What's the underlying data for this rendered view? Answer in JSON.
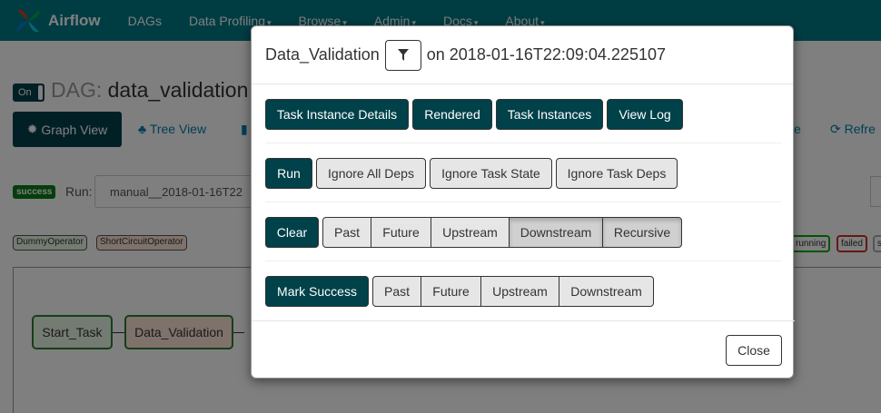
{
  "navbar": {
    "brand": "Airflow",
    "items": [
      {
        "label": "DAGs"
      },
      {
        "label": "Data Profiling",
        "caret": "▾"
      },
      {
        "label": "Browse",
        "caret": "▾"
      },
      {
        "label": "Admin",
        "caret": "▾"
      },
      {
        "label": "Docs",
        "caret": "▾"
      },
      {
        "label": "About",
        "caret": "▾"
      }
    ]
  },
  "page": {
    "toggle_label": "On",
    "dag_prefix": "DAG: ",
    "dag_name": "data_validation",
    "graph_view": "Graph View",
    "tree_view": "Tree View",
    "right_partial": "e",
    "refresh": "Refre",
    "success_badge": "success",
    "run_label": "Run:",
    "run_value": "manual__2018-01-16T22",
    "operators": [
      "DummyOperator",
      "ShortCircuitOperator"
    ],
    "states": [
      "running",
      "failed",
      "s"
    ],
    "nodes": [
      "Start_Task",
      "Data_Validation"
    ]
  },
  "modal": {
    "task_name": "Data_Validation",
    "on_text": "on 2018-01-16T22:09:04.225107",
    "row1": [
      "Task Instance Details",
      "Rendered",
      "Task Instances",
      "View Log"
    ],
    "run_row": {
      "primary": "Run",
      "options": [
        "Ignore All Deps",
        "Ignore Task State",
        "Ignore Task Deps"
      ]
    },
    "clear_row": {
      "primary": "Clear",
      "options": [
        "Past",
        "Future",
        "Upstream",
        "Downstream",
        "Recursive"
      ],
      "pressed": [
        "Downstream",
        "Recursive"
      ]
    },
    "mark_row": {
      "primary": "Mark Success",
      "options": [
        "Past",
        "Future",
        "Upstream",
        "Downstream"
      ]
    },
    "close": "Close"
  },
  "colors": {
    "navbar": "#007a87",
    "primary_button": "#00414a",
    "light_button": "#e6e6e6",
    "success": "#0a7d18",
    "failed": "#c9332a",
    "running": "#01ab08"
  }
}
